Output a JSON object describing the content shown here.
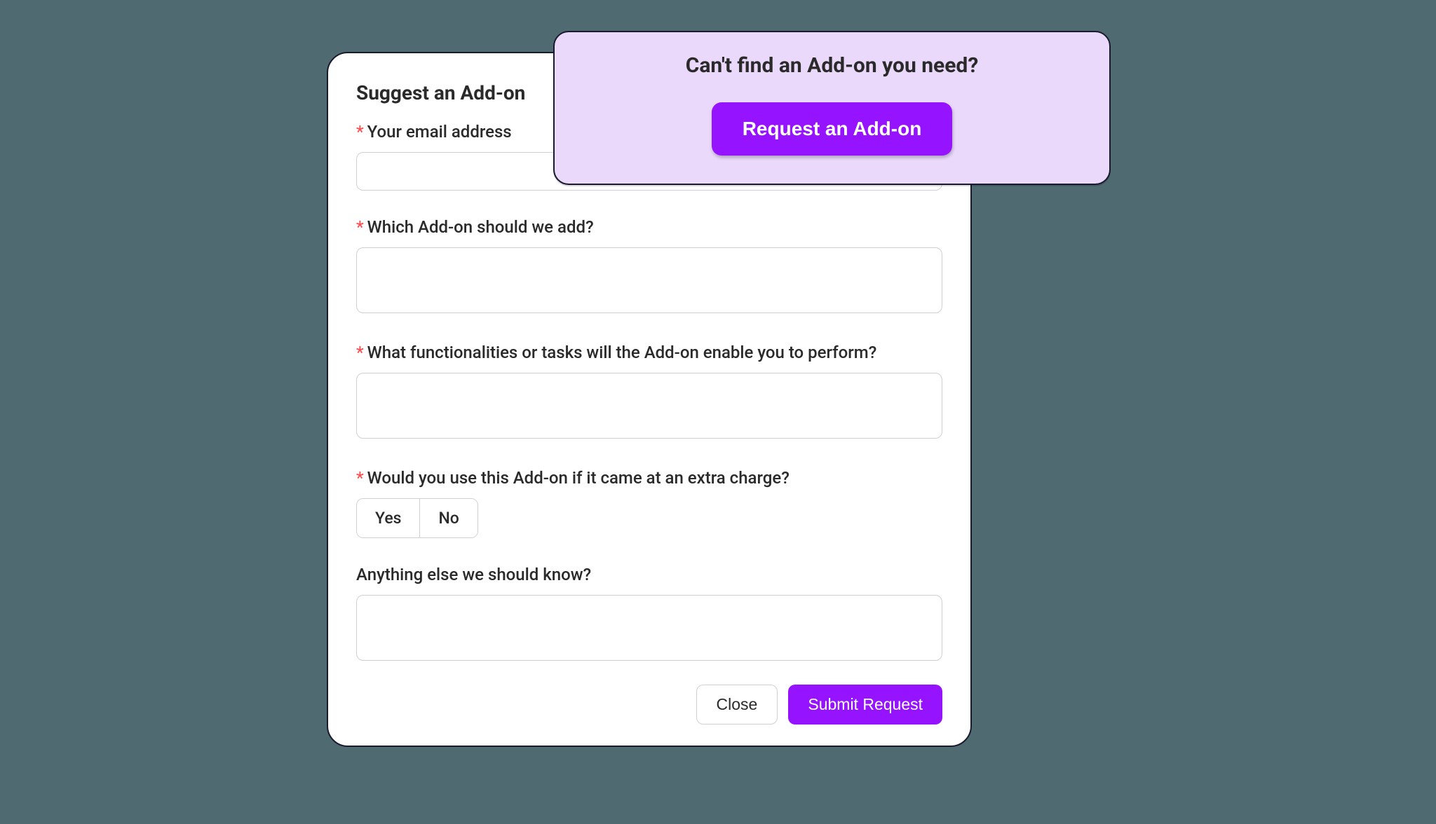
{
  "modal": {
    "title": "Suggest an Add-on",
    "fields": {
      "email": {
        "label": "Your email address",
        "required": true
      },
      "addon": {
        "label": "Which Add-on should we add?",
        "required": true
      },
      "functionalities": {
        "label": "What functionalities or tasks will the Add-on enable you to perform?",
        "required": true
      },
      "extra_charge": {
        "label": "Would you use this Add-on if it came at an extra charge?",
        "required": true,
        "options": {
          "yes": "Yes",
          "no": "No"
        }
      },
      "anything_else": {
        "label": "Anything else we should know?",
        "required": false
      }
    },
    "buttons": {
      "close": "Close",
      "submit": "Submit Request"
    }
  },
  "popup": {
    "title": "Can't find an Add-on you need?",
    "button": "Request an Add-on"
  },
  "required_mark": "*"
}
